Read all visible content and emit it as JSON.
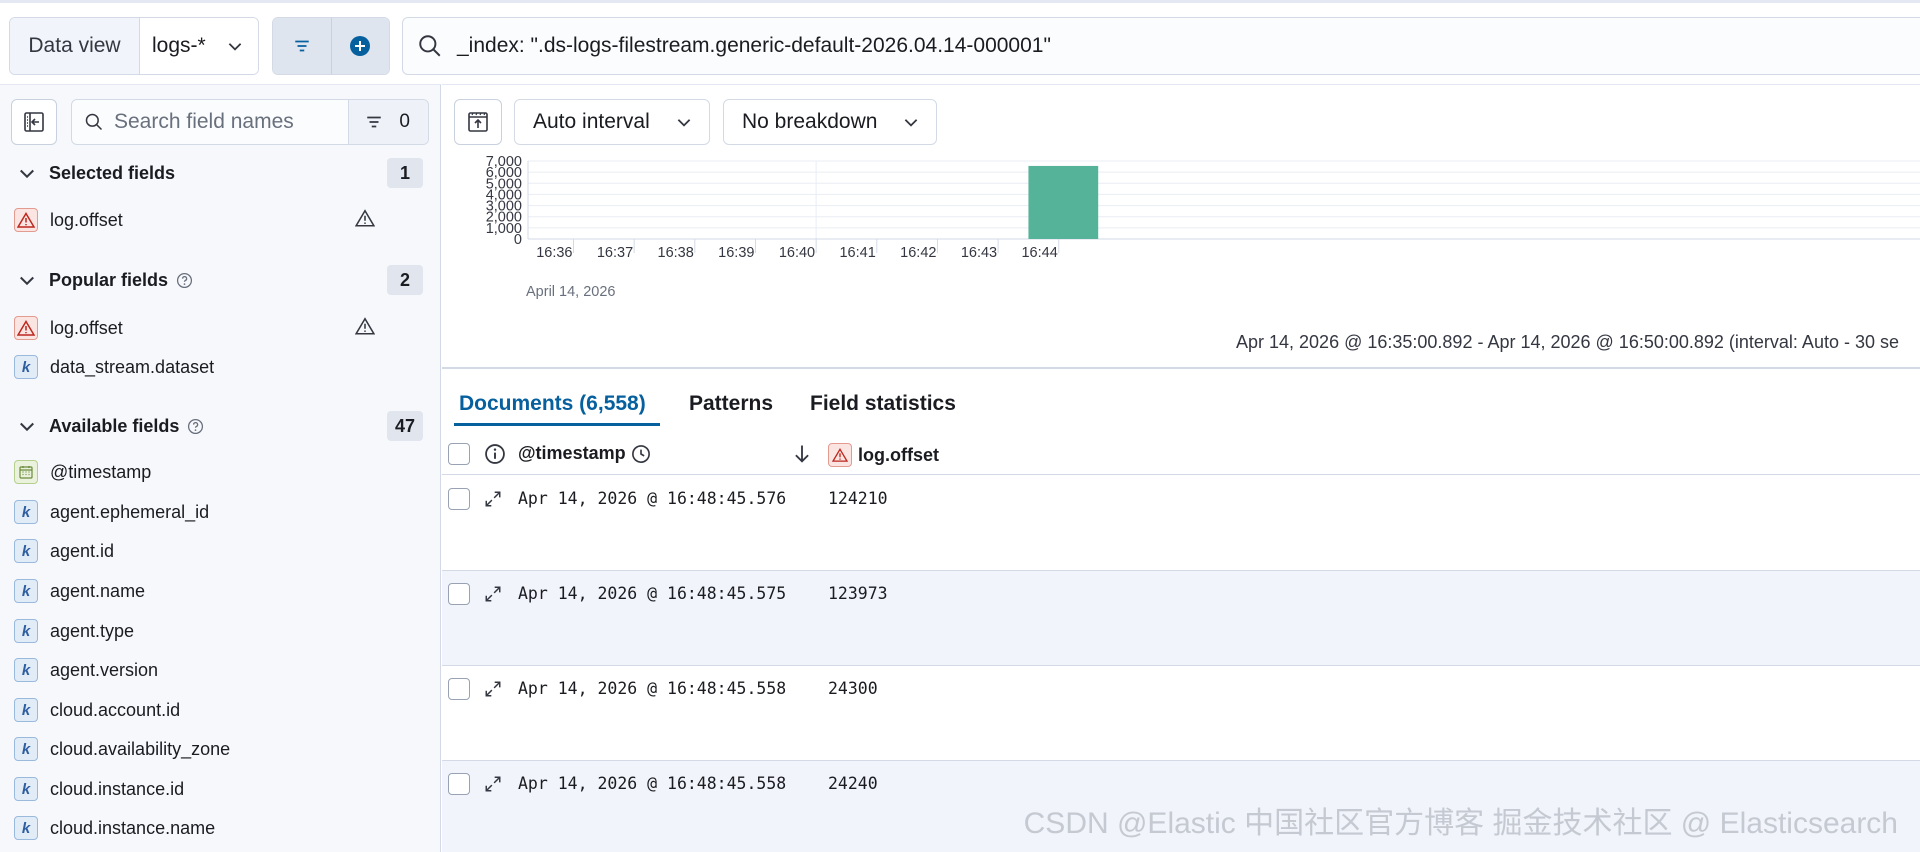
{
  "topbar": {
    "data_view_label": "Data view",
    "data_view_value": "logs-*",
    "query": "_index: \".ds-logs-filestream.generic-default-2026.04.14-000001\""
  },
  "sidebar": {
    "search_placeholder": "Search field names",
    "filter_count": "0",
    "selected": {
      "title": "Selected fields",
      "count": "1",
      "fields": [
        {
          "name": "log.offset",
          "type": "warning"
        }
      ]
    },
    "popular": {
      "title": "Popular fields",
      "count": "2",
      "fields": [
        {
          "name": "log.offset",
          "type": "warning"
        },
        {
          "name": "data_stream.dataset",
          "type": "keyword"
        }
      ]
    },
    "available": {
      "title": "Available fields",
      "count": "47",
      "fields": [
        {
          "name": "@timestamp",
          "type": "date"
        },
        {
          "name": "agent.ephemeral_id",
          "type": "keyword"
        },
        {
          "name": "agent.id",
          "type": "keyword"
        },
        {
          "name": "agent.name",
          "type": "keyword"
        },
        {
          "name": "agent.type",
          "type": "keyword"
        },
        {
          "name": "agent.version",
          "type": "keyword"
        },
        {
          "name": "cloud.account.id",
          "type": "keyword"
        },
        {
          "name": "cloud.availability_zone",
          "type": "keyword"
        },
        {
          "name": "cloud.instance.id",
          "type": "keyword"
        },
        {
          "name": "cloud.instance.name",
          "type": "keyword"
        }
      ]
    },
    "keyword_glyph": "k"
  },
  "toolbar": {
    "interval_label": "Auto interval",
    "breakdown_label": "No breakdown"
  },
  "chart_data": {
    "type": "bar",
    "x_ticks": [
      "16:36",
      "16:37",
      "16:38",
      "16:39",
      "16:40",
      "16:41",
      "16:42",
      "16:43",
      "16:44"
    ],
    "x_date_label": "April 14, 2026",
    "y_ticks": [
      "7,000",
      "6,000",
      "5,000",
      "4,000",
      "3,000",
      "2,000",
      "1,000",
      "0"
    ],
    "ylim": [
      0,
      7000
    ],
    "bars": [
      {
        "start": "16:43:30",
        "value": 6558
      }
    ],
    "bar_color": "#54b399"
  },
  "time_range": "Apr 14, 2026 @ 16:35:00.892 - Apr 14, 2026 @ 16:50:00.892 (interval: Auto - 30 se",
  "tabs": [
    {
      "label": "Documents (6,558)",
      "active": true
    },
    {
      "label": "Patterns",
      "active": false
    },
    {
      "label": "Field statistics",
      "active": false
    }
  ],
  "table": {
    "columns": [
      "@timestamp",
      "log.offset"
    ],
    "rows": [
      {
        "timestamp": "Apr 14, 2026 @ 16:48:45.576",
        "offset": "124210"
      },
      {
        "timestamp": "Apr 14, 2026 @ 16:48:45.575",
        "offset": "123973"
      },
      {
        "timestamp": "Apr 14, 2026 @ 16:48:45.558",
        "offset": "24300"
      },
      {
        "timestamp": "Apr 14, 2026 @ 16:48:45.558",
        "offset": "24240"
      }
    ]
  },
  "watermark": "CSDN @Elastic 中国社区官方博客  掘金技术社区 @ Elasticsearch"
}
